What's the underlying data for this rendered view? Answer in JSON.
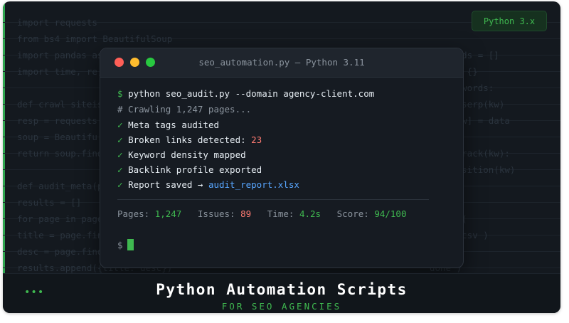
{
  "background_code": {
    "left": [
      "import requests",
      "from bs4 import BeautifulSoup",
      "import pandas as",
      "import time, re,",
      "",
      "def crawl siteis",
      "resp = requests",
      "soup = Beautifu",
      "return soup.find",
      "",
      "def audit_meta(pa",
      "results = []",
      "for page in pages",
      "title = page.find",
      "desc = page.find",
      "results.append({title: desc})"
    ],
    "right": [
      "",
      "keywords = []",
      "data = {}",
      "in keywords:",
      "fetch serp(kw)",
      "data[kw] = data",
      "",
      "rank track(kw):",
      "get position(kw)",
      "csv",
      "",
      "to csv(",
      "audit.csv )",
      "",
      "done )"
    ]
  },
  "badge": "Python 3.x",
  "terminal": {
    "title": "seo_automation.py — Python 3.11",
    "command": {
      "prompt": "$",
      "text": "python seo_audit.py --domain agency-client.com"
    },
    "comment": "# Crawling 1,247 pages...",
    "checks": [
      {
        "mark": "✓",
        "text": "Meta tags audited",
        "extra": ""
      },
      {
        "mark": "✓",
        "text": "Broken links detected: ",
        "extra": "23"
      },
      {
        "mark": "✓",
        "text": "Keyword density mapped",
        "extra": ""
      },
      {
        "mark": "✓",
        "text": "Backlink profile exported",
        "extra": ""
      },
      {
        "mark": "✓",
        "text": "Report saved → ",
        "extra": "audit_report.xlsx"
      }
    ],
    "stats": [
      {
        "label": "Pages:",
        "value": "1,247"
      },
      {
        "label": "Issues:",
        "value": "89"
      },
      {
        "label": "Time:",
        "value": "4.2s"
      },
      {
        "label": "Score:",
        "value": "94/100"
      }
    ],
    "final_prompt": "$"
  },
  "footer": {
    "dots": "•••",
    "title": "Python Automation Scripts",
    "subtitle": "FOR SEO AGENCIES"
  },
  "colors": {
    "accent": "#3fb950",
    "error": "#ff7b72",
    "link": "#58a6ff",
    "bg": "#14191f"
  }
}
